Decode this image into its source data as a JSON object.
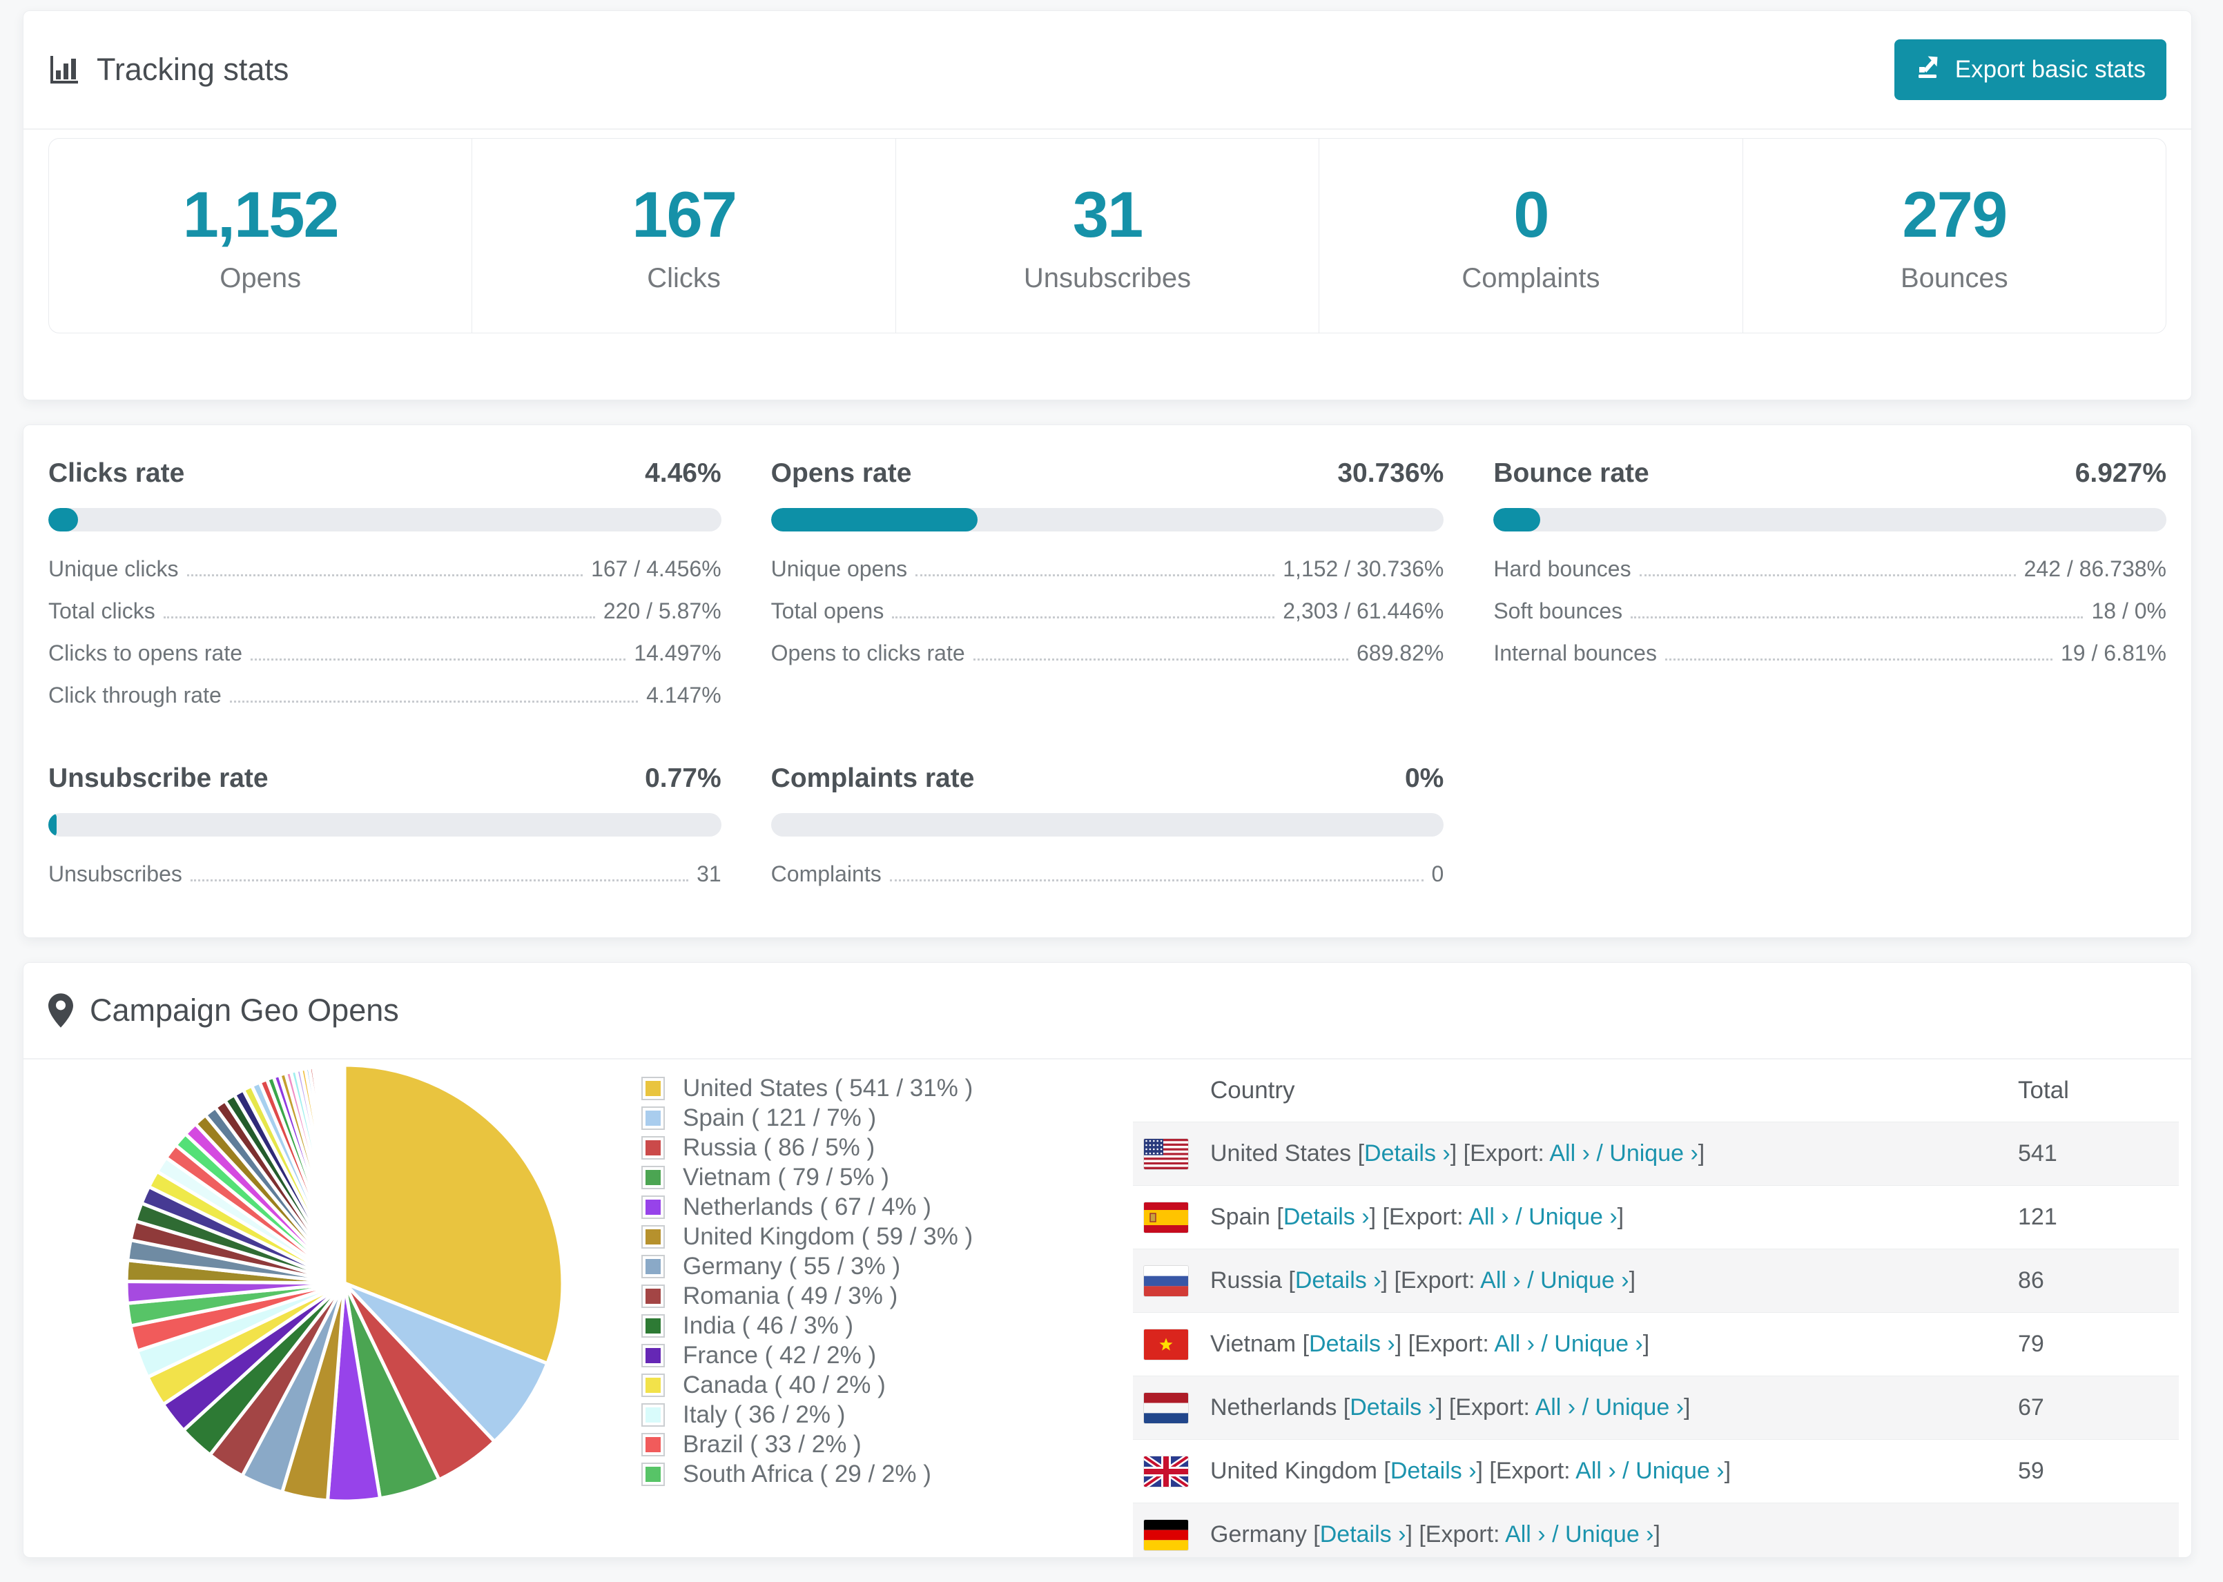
{
  "colors": {
    "accent": "#1191a7",
    "bar_fill": "#0d90a7",
    "link": "#1b93ad",
    "track": "#e9ebef",
    "stat_number": "#1691a8"
  },
  "tracking": {
    "title": "Tracking stats",
    "export_label": "Export basic stats",
    "stats": [
      {
        "value": "1,152",
        "label": "Opens"
      },
      {
        "value": "167",
        "label": "Clicks"
      },
      {
        "value": "31",
        "label": "Unsubscribes"
      },
      {
        "value": "0",
        "label": "Complaints"
      },
      {
        "value": "279",
        "label": "Bounces"
      }
    ]
  },
  "rates": {
    "panels": [
      {
        "title": "Clicks rate",
        "value": "4.46%",
        "percent": 4.46,
        "items": [
          {
            "label": "Unique clicks",
            "value": "167 / 4.456%"
          },
          {
            "label": "Total clicks",
            "value": "220 / 5.87%"
          },
          {
            "label": "Clicks to opens rate",
            "value": "14.497%"
          },
          {
            "label": "Click through rate",
            "value": "4.147%"
          }
        ]
      },
      {
        "title": "Opens rate",
        "value": "30.736%",
        "percent": 30.736,
        "items": [
          {
            "label": "Unique opens",
            "value": "1,152 / 30.736%"
          },
          {
            "label": "Total opens",
            "value": "2,303 / 61.446%"
          },
          {
            "label": "Opens to clicks rate",
            "value": "689.82%"
          }
        ]
      },
      {
        "title": "Bounce rate",
        "value": "6.927%",
        "percent": 6.927,
        "items": [
          {
            "label": "Hard bounces",
            "value": "242 / 86.738%"
          },
          {
            "label": "Soft bounces",
            "value": "18 / 0%"
          },
          {
            "label": "Internal bounces",
            "value": "19 / 6.81%"
          }
        ]
      },
      {
        "title": "Unsubscribe rate",
        "value": "0.77%",
        "percent": 0.77,
        "items": [
          {
            "label": "Unsubscribes",
            "value": "31"
          }
        ]
      },
      {
        "title": "Complaints rate",
        "value": "0%",
        "percent": 0,
        "items": [
          {
            "label": "Complaints",
            "value": "0"
          }
        ]
      }
    ]
  },
  "geo": {
    "title": "Campaign Geo Opens",
    "legend": [
      {
        "label": "United States ( 541 / 31% )",
        "color": "#e9c43f"
      },
      {
        "label": "Spain ( 121 / 7% )",
        "color": "#a9cdee"
      },
      {
        "label": "Russia ( 86 / 5% )",
        "color": "#cb4a4a"
      },
      {
        "label": "Vietnam ( 79 / 5% )",
        "color": "#4ba552"
      },
      {
        "label": "Netherlands ( 67 / 4% )",
        "color": "#9743ea"
      },
      {
        "label": "United Kingdom ( 59 / 3% )",
        "color": "#b6912d"
      },
      {
        "label": "Germany ( 55 / 3% )",
        "color": "#8aa9c7"
      },
      {
        "label": "Romania ( 49 / 3% )",
        "color": "#a34545"
      },
      {
        "label": "India ( 46 / 3% )",
        "color": "#2d7a34"
      },
      {
        "label": "France ( 42 / 2% )",
        "color": "#6527b5"
      },
      {
        "label": "Canada ( 40 / 2% )",
        "color": "#f2e24a"
      },
      {
        "label": "Italy ( 36 / 2% )",
        "color": "#d9fbfb"
      },
      {
        "label": "Brazil ( 33 / 2% )",
        "color": "#f15b5b"
      },
      {
        "label": "South Africa ( 29 / 2% )",
        "color": "#57c467"
      }
    ],
    "table": {
      "country_header": "Country",
      "total_header": "Total",
      "bracket_open": "[",
      "bracket_close": "]",
      "details_label": "Details ›",
      "export_prefix": "Export:",
      "all_label": "All ›",
      "separator": "/",
      "unique_label": "Unique ›",
      "rows": [
        {
          "country": "United States",
          "flag": "us",
          "total": "541"
        },
        {
          "country": "Spain",
          "flag": "es",
          "total": "121"
        },
        {
          "country": "Russia",
          "flag": "ru",
          "total": "86"
        },
        {
          "country": "Vietnam",
          "flag": "vn",
          "total": "79"
        },
        {
          "country": "Netherlands",
          "flag": "nl",
          "total": "67"
        },
        {
          "country": "United Kingdom",
          "flag": "gb",
          "total": "59"
        },
        {
          "country": "Germany",
          "flag": "de",
          "total": ""
        }
      ]
    },
    "chart_data": {
      "type": "pie",
      "title": "Campaign Geo Opens",
      "legend_position": "right",
      "start_angle_deg": -90,
      "direction": "clockwise",
      "slices": [
        {
          "label": "United States",
          "value": 541,
          "pct": 31,
          "color": "#e9c43f"
        },
        {
          "label": "Spain",
          "value": 121,
          "pct": 7,
          "color": "#a9cdee"
        },
        {
          "label": "Russia",
          "value": 86,
          "pct": 5,
          "color": "#cb4a4a"
        },
        {
          "label": "Vietnam",
          "value": 79,
          "pct": 5,
          "color": "#4ba552"
        },
        {
          "label": "Netherlands",
          "value": 67,
          "pct": 4,
          "color": "#9743ea"
        },
        {
          "label": "United Kingdom",
          "value": 59,
          "pct": 3,
          "color": "#b6912d"
        },
        {
          "label": "Germany",
          "value": 55,
          "pct": 3,
          "color": "#8aa9c7"
        },
        {
          "label": "Romania",
          "value": 49,
          "pct": 3,
          "color": "#a34545"
        },
        {
          "label": "India",
          "value": 46,
          "pct": 3,
          "color": "#2d7a34"
        },
        {
          "label": "France",
          "value": 42,
          "pct": 2,
          "color": "#6527b5"
        },
        {
          "label": "Canada",
          "value": 40,
          "pct": 2,
          "color": "#f2e24a"
        },
        {
          "label": "Italy",
          "value": 36,
          "pct": 2,
          "color": "#d9fbfb"
        },
        {
          "label": "Brazil",
          "value": 33,
          "pct": 2,
          "color": "#f15b5b"
        },
        {
          "label": "South Africa",
          "value": 29,
          "pct": 2,
          "color": "#57c467"
        }
      ],
      "other_slices": {
        "note": "many small unlabeled countries",
        "values": [
          28,
          27,
          26,
          25,
          24,
          23,
          22,
          21,
          20,
          19,
          18,
          17,
          16,
          15,
          14,
          13,
          12,
          11,
          10,
          9,
          8,
          8,
          7,
          7,
          6,
          6,
          5,
          5,
          4,
          4,
          3,
          3,
          3,
          2,
          2,
          2,
          2,
          2,
          1,
          1,
          1,
          1,
          1,
          1,
          1,
          1,
          1,
          1,
          1,
          1,
          1
        ],
        "colors": [
          "#a64ae0",
          "#a08a28",
          "#6f8ba3",
          "#8f3a3a",
          "#2f6b33",
          "#463a93",
          "#efe94a",
          "#e6fcfc",
          "#ef5f5f",
          "#54e077",
          "#d44ae0",
          "#9c7f1f",
          "#5f7d99",
          "#7d2f2f",
          "#245c2b",
          "#2f2a78",
          "#e6e64a",
          "#a6d0ef",
          "#df4a4a",
          "#3aa64a",
          "#8f3ae0",
          "#c49f2f",
          "#ef8fc4",
          "#9fefef",
          "#bfa6ef",
          "#efbf3f",
          "#78bfe6",
          "#cf5454",
          "#57b863",
          "#9a50e0",
          "#b6901f",
          "#6b84a0",
          "#a03f3f",
          "#2f6b3a",
          "#4f3f99",
          "#efef54",
          "#b0d8f8",
          "#e05454",
          "#45a852",
          "#a054e0",
          "#caa636",
          "#f493ce",
          "#baf4f4",
          "#d3baf4",
          "#f4c945",
          "#80c4ea",
          "#d45f5f",
          "#5fba6b",
          "#a45fe4",
          "#bc9426",
          "#708aa6"
        ]
      }
    }
  }
}
